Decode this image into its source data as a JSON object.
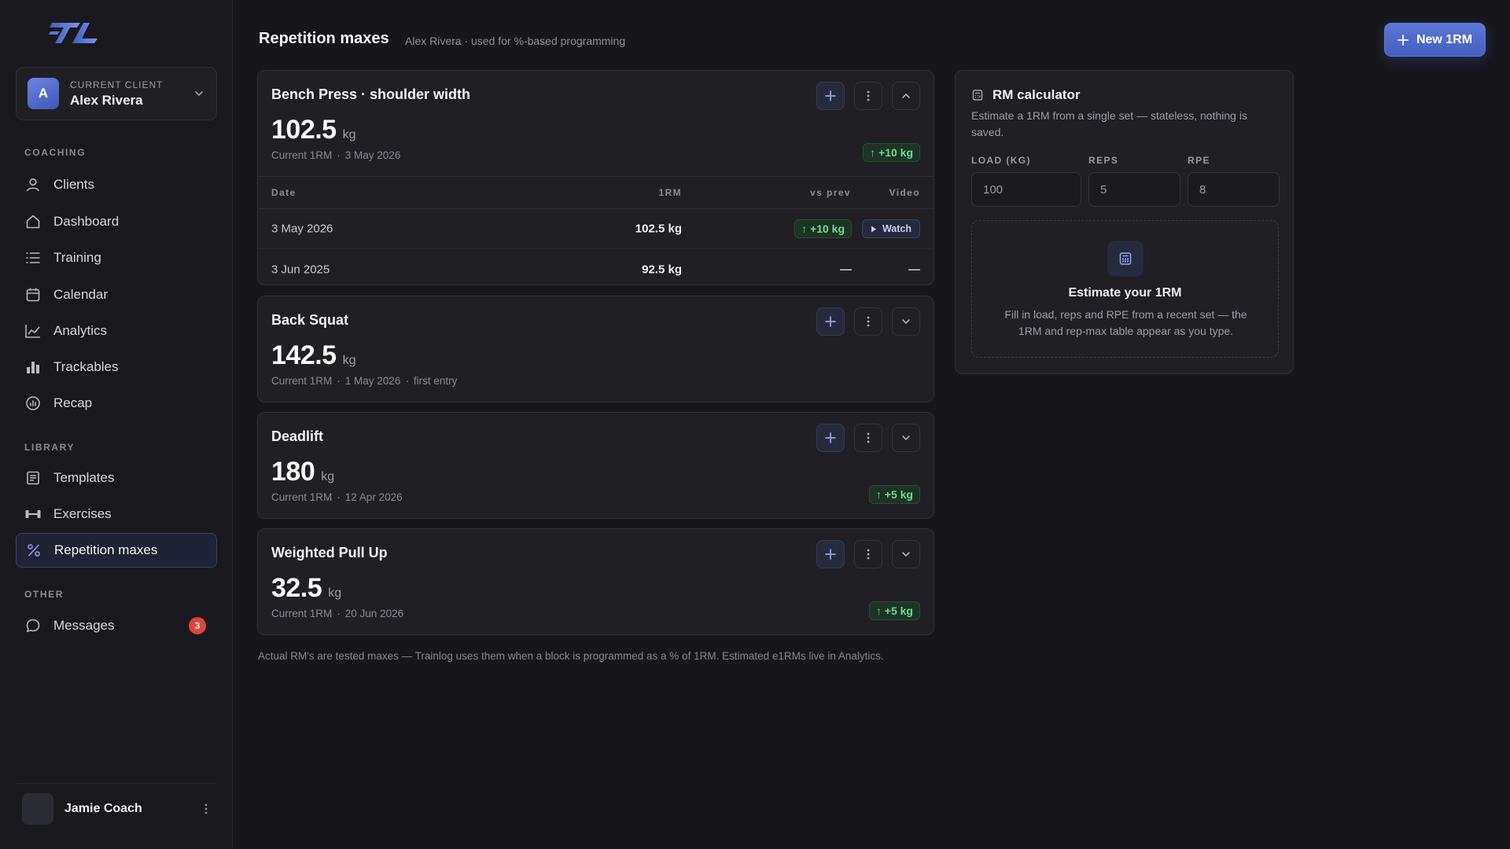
{
  "app": {
    "logo_text": "TL"
  },
  "client": {
    "label": "CURRENT CLIENT",
    "initial": "A",
    "name": "Alex Rivera"
  },
  "nav": {
    "coaching_label": "COACHING",
    "library_label": "LIBRARY",
    "other_label": "OTHER",
    "items": [
      {
        "label": "Clients",
        "icon": "user-icon"
      },
      {
        "label": "Dashboard",
        "icon": "home-icon"
      },
      {
        "label": "Training",
        "icon": "list-icon"
      },
      {
        "label": "Calendar",
        "icon": "calendar-icon"
      },
      {
        "label": "Analytics",
        "icon": "line-chart-icon"
      },
      {
        "label": "Trackables",
        "icon": "bar-chart-icon"
      },
      {
        "label": "Recap",
        "icon": "gauge-icon"
      },
      {
        "label": "Templates",
        "icon": "document-icon"
      },
      {
        "label": "Exercises",
        "icon": "dumbbell-icon"
      },
      {
        "label": "Repetition maxes",
        "icon": "percent-icon",
        "active": true
      },
      {
        "label": "Messages",
        "icon": "chat-icon",
        "badge": "3"
      }
    ]
  },
  "user": {
    "name": "Jamie Coach"
  },
  "header": {
    "title": "Repetition maxes",
    "subtitle": "Alex Rivera · used for %-based programming",
    "new_button": "New 1RM"
  },
  "table_headers": {
    "date": "Date",
    "rm": "1RM",
    "vs_prev": "vs prev",
    "video": "Video"
  },
  "lifts": [
    {
      "name": "Bench Press · shoulder width",
      "value": "102.5",
      "unit": "kg",
      "meta_label": "Current 1RM",
      "meta_sep": "·",
      "date": "3 May 2026",
      "delta": "↑ +10 kg",
      "expanded": true,
      "history": [
        {
          "date": "3 May 2026",
          "rm": "102.5 kg",
          "vs_prev": "↑ +10 kg",
          "video": "Watch"
        },
        {
          "date": "3 Jun 2025",
          "rm": "92.5 kg",
          "vs_prev": "—",
          "video": "—"
        }
      ]
    },
    {
      "name": "Back Squat",
      "value": "142.5",
      "unit": "kg",
      "meta_label": "Current 1RM",
      "meta_sep": "·",
      "date": "1 May 2026",
      "note": "first entry"
    },
    {
      "name": "Deadlift",
      "value": "180",
      "unit": "kg",
      "meta_label": "Current 1RM",
      "meta_sep": "·",
      "date": "12 Apr 2026",
      "delta": "↑ +5 kg"
    },
    {
      "name": "Weighted Pull Up",
      "value": "32.5",
      "unit": "kg",
      "meta_label": "Current 1RM",
      "meta_sep": "·",
      "date": "20 Jun 2026",
      "delta": "↑ +5 kg"
    }
  ],
  "footnote": "Actual RM's are tested maxes — Trainlog uses them when a block is programmed as a % of 1RM. Estimated e1RMs live in Analytics.",
  "calculator": {
    "title": "RM calculator",
    "description": "Estimate a 1RM from a single set — stateless, nothing is saved.",
    "load_label": "LOAD (KG)",
    "load_placeholder": "100",
    "reps_label": "REPS",
    "reps_placeholder": "5",
    "rpe_label": "RPE",
    "rpe_placeholder": "8",
    "empty_title": "Estimate your 1RM",
    "empty_desc": "Fill in load, reps and RPE from a recent set — the 1RM and rep-max table appear as you type."
  },
  "colors": {
    "accent": "#5b76d6",
    "positive": "#6fdc8a",
    "badge": "#e0433b",
    "background": "#17171b",
    "card": "#1f1f24"
  }
}
